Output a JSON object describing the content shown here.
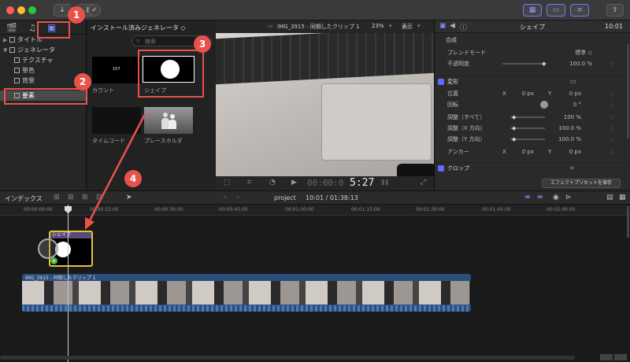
{
  "titlebar": {
    "download_icon": "↓",
    "key_icon": "⚷",
    "check_icon": "✓",
    "share_icon": "⇪"
  },
  "library": {
    "items": [
      {
        "label": "タイトル",
        "expanded": false
      },
      {
        "label": "ジェネレータ",
        "expanded": true
      },
      {
        "label": "テクスチャ"
      },
      {
        "label": "単色"
      },
      {
        "label": "背景"
      },
      {
        "label": "要素",
        "selected": true
      }
    ]
  },
  "browser": {
    "header": "インストール済みジェネレータ ◇",
    "search_placeholder": "検索",
    "thumbs": [
      {
        "caption": "カウント",
        "inner_text": "157"
      },
      {
        "caption": "シェイプ"
      },
      {
        "caption": "タイムコード"
      },
      {
        "caption": "プレースホルダ"
      }
    ]
  },
  "viewer": {
    "title": "IMG_3915 - 同期したクリップ 1",
    "zoom": "23%",
    "display": "表示",
    "timecode_dim": "00:00:0",
    "timecode": "5:27"
  },
  "inspector": {
    "title": "シェイプ",
    "time": "10:01",
    "compositing": "合成",
    "blend_label": "ブレンドモード",
    "blend_value": "標準 ◇",
    "opacity_label": "不透明度",
    "opacity_value": "100.0 %",
    "transform": "変形",
    "position_label": "位置",
    "x": "X",
    "y": "Y",
    "pos_x": "0 px",
    "pos_y": "0 px",
    "rotation_label": "回転",
    "rotation_value": "0 °",
    "scale_all_label": "調整（すべて）",
    "scale_all": "100 %",
    "scale_x_label": "調整（X 方向）",
    "scale_x": "100.0 %",
    "scale_y_label": "調整（Y 方向）",
    "scale_y": "100.0 %",
    "anchor_label": "アンカー",
    "anchor_x": "0 px",
    "anchor_y": "0 px",
    "crop": "クロップ",
    "save_preset": "エフェクトプリセットを保存"
  },
  "timeline": {
    "index": "インデックス",
    "project": "project",
    "duration": "10:01 / 01:38:13",
    "ruler": [
      "00:00:00:00",
      "00:00:15:00",
      "00:00:30:00",
      "00:00:45:00",
      "00:01:00:00",
      "00:01:15:00",
      "00:01:30:00",
      "00:01:45:00",
      "00:02:00:00"
    ],
    "shape_clip": "シェイプ",
    "video_clip": "IMG_3915 - 同期したクリップ 1"
  },
  "callouts": [
    "1",
    "2",
    "3",
    "4"
  ],
  "colors": {
    "accent": "#e8524b",
    "selection": "#4a4a4a",
    "clip_yellow": "#e6c23a",
    "clip_blue": "#2b4d7a",
    "active_blue": "#6b7cff"
  }
}
